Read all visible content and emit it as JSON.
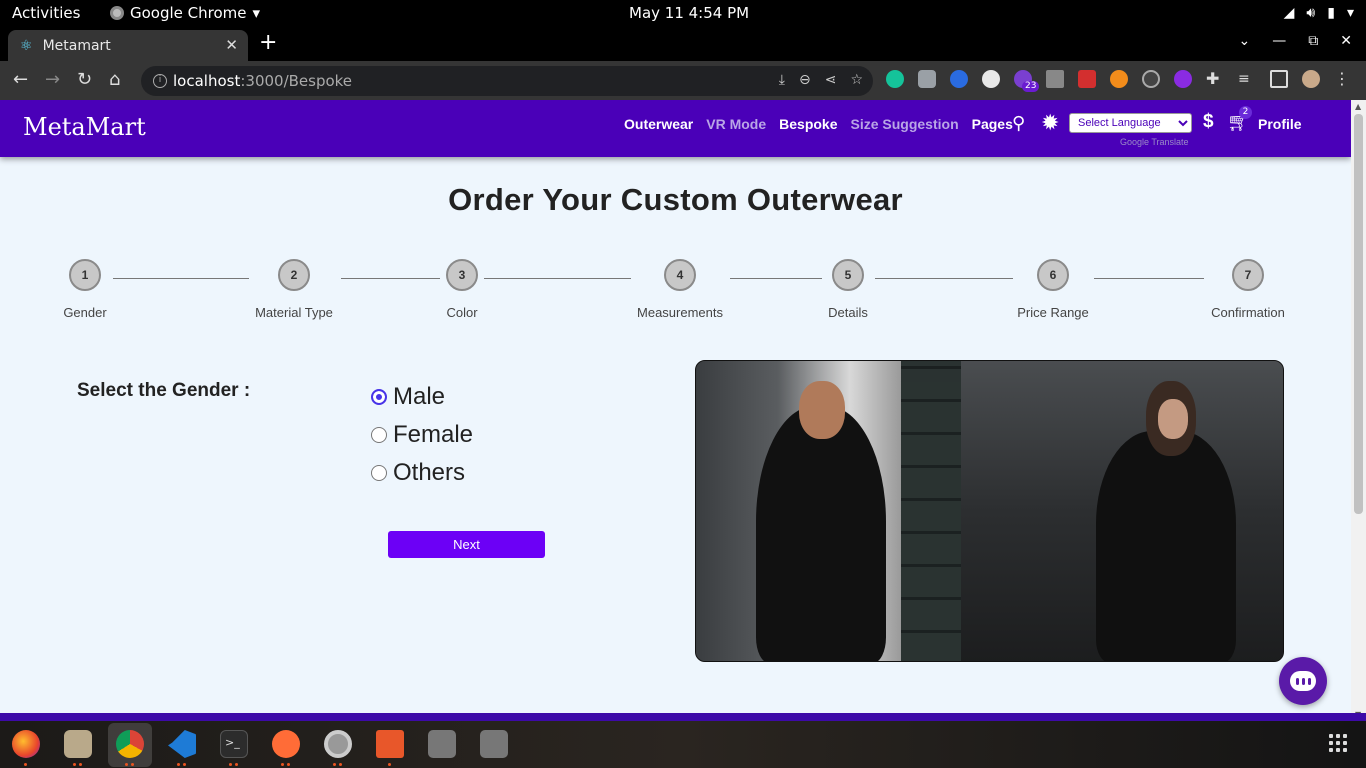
{
  "system_bar": {
    "activities": "Activities",
    "app_name": "Google Chrome",
    "clock": "May 11   4:54 PM"
  },
  "browser": {
    "tab_title": "Metamart",
    "url_host": "localhost",
    "url_path": ":3000/Bespoke",
    "extension_badge": "23"
  },
  "site": {
    "brand": "MetaMart",
    "nav": [
      {
        "label": "Outerwear"
      },
      {
        "label": "VR Mode"
      },
      {
        "label": "Bespoke"
      },
      {
        "label": "Size Suggestion"
      },
      {
        "label": "Pages"
      }
    ],
    "language_select": "Select Language",
    "powered_by": "Google Translate",
    "currency_icon": "$",
    "cart_count": "2",
    "profile": "Profile"
  },
  "page": {
    "title": "Order Your Custom Outerwear",
    "steps": [
      {
        "num": "1",
        "label": "Gender"
      },
      {
        "num": "2",
        "label": "Material Type"
      },
      {
        "num": "3",
        "label": "Color"
      },
      {
        "num": "4",
        "label": "Measurements"
      },
      {
        "num": "5",
        "label": "Details"
      },
      {
        "num": "6",
        "label": "Price Range"
      },
      {
        "num": "7",
        "label": "Confirmation"
      }
    ],
    "gender_label": "Select the Gender :",
    "options": [
      {
        "label": "Male",
        "checked": true
      },
      {
        "label": "Female",
        "checked": false
      },
      {
        "label": "Others",
        "checked": false
      }
    ],
    "next_button": "Next"
  },
  "colors": {
    "nav_bg": "#4a00b8",
    "accent": "#6c00f6",
    "page_bg": "#eef6fd"
  }
}
